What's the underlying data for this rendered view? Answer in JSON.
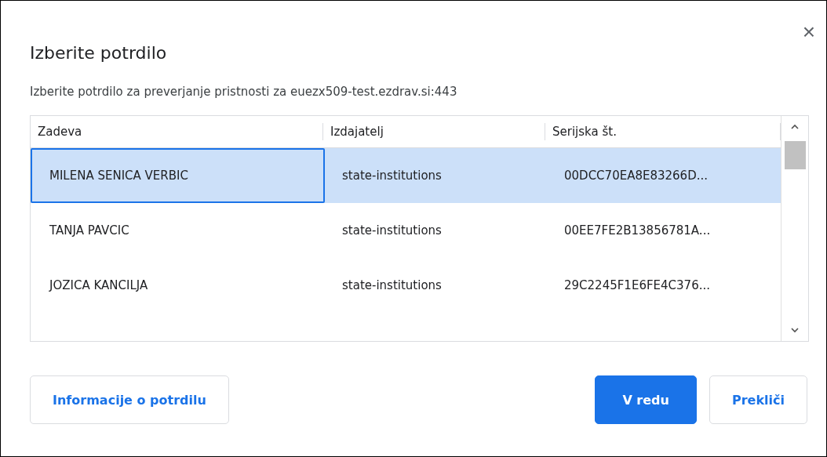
{
  "dialog": {
    "title": "Izberite potrdilo",
    "subtitle": "Izberite potrdilo za preverjanje pristnosti za euezx509-test.ezdrav.si:443",
    "close": "×"
  },
  "table": {
    "columns": [
      "Zadeva",
      "Izdajatelj",
      "Serijska št."
    ],
    "rows": [
      {
        "cells": [
          "MILENA SENICA VERBIC",
          "state-institutions",
          "00DCC70EA8E83266D..."
        ],
        "selected": true
      },
      {
        "cells": [
          "TANJA PAVCIC",
          "state-institutions",
          "00EE7FE2B13856781A..."
        ],
        "selected": false
      },
      {
        "cells": [
          "JOZICA KANCILJA",
          "state-institutions",
          "29C2245F1E6FE4C376..."
        ],
        "selected": false
      }
    ]
  },
  "buttons": [
    {
      "label": "Informacije o potrdilu",
      "kind": "secondary"
    },
    {
      "label": "V redu",
      "kind": "primary"
    },
    {
      "label": "Prekliči",
      "kind": "secondary"
    }
  ]
}
